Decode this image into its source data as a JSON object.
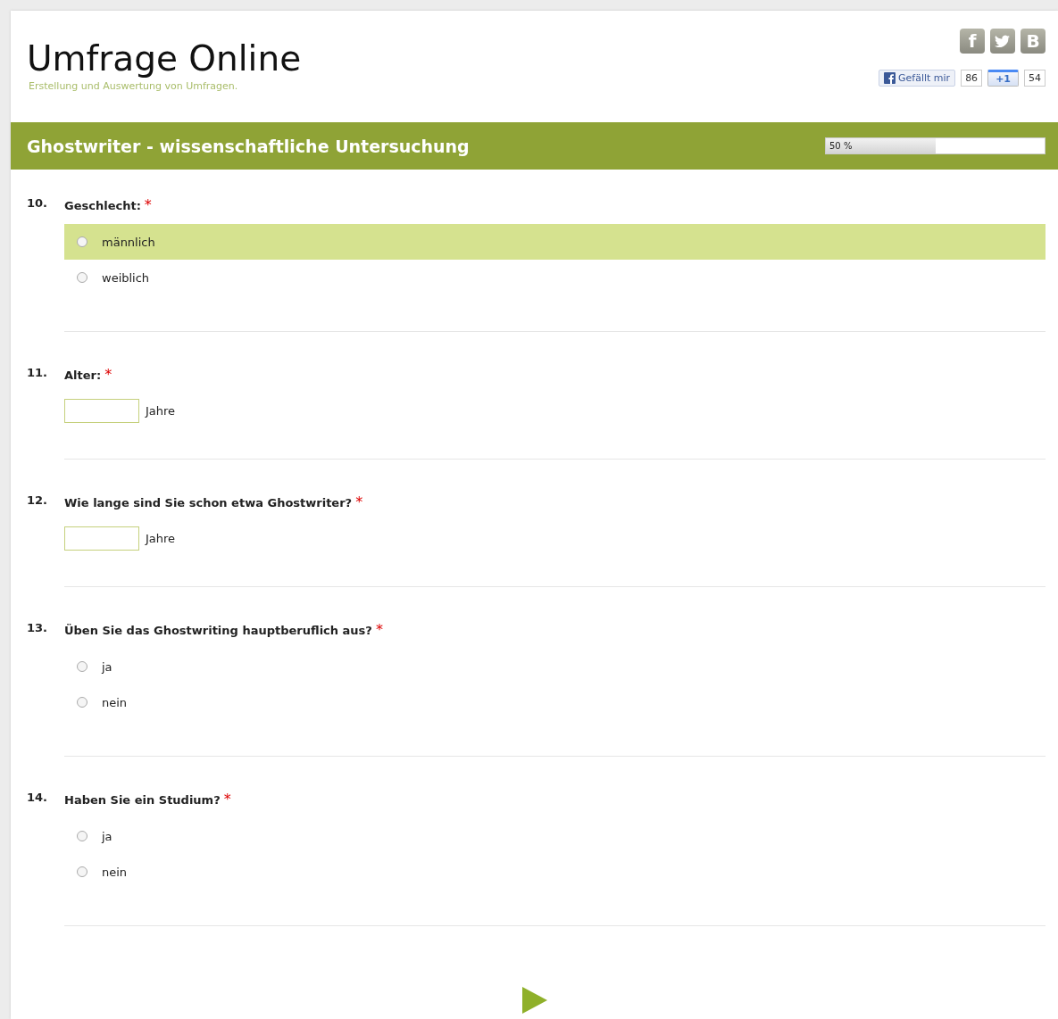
{
  "header": {
    "title": "Umfrage Online",
    "subtitle": "Erstellung und Auswertung von Umfragen.",
    "share_buttons": [
      {
        "kind": "letter",
        "label": "f"
      },
      {
        "kind": "bird"
      },
      {
        "kind": "letter",
        "label": "B"
      }
    ],
    "like_button": {
      "label": "Gefällt mir",
      "count": "86"
    },
    "plusone_button": {
      "label": "+1",
      "count": "54"
    }
  },
  "survey_bar": {
    "title": "Ghostwriter - wissenschaftliche Untersuchung",
    "progress": {
      "label": "50 %",
      "level": 0.5
    }
  },
  "questions": [
    {
      "number": "10.",
      "label": "Geschlecht:",
      "required_mark": "*",
      "kind": "radio",
      "options": [
        {
          "label": "männlich",
          "selected": false,
          "highlighted": true
        },
        {
          "label": "weiblich",
          "selected": false,
          "highlighted": false
        }
      ]
    },
    {
      "number": "11.",
      "label": "Alter:",
      "required_mark": "*",
      "kind": "text",
      "unit": "Jahre"
    },
    {
      "number": "12.",
      "label": "Wie lange sind Sie schon etwa Ghostwriter?",
      "required_mark": "*",
      "kind": "text",
      "unit": "Jahre"
    },
    {
      "number": "13.",
      "label": "Üben Sie das Ghostwriting hauptberuflich aus?",
      "required_mark": "*",
      "kind": "radio",
      "options": [
        {
          "label": "ja",
          "selected": false,
          "highlighted": false
        },
        {
          "label": "nein",
          "selected": false,
          "highlighted": false
        }
      ]
    },
    {
      "number": "14.",
      "label": "Haben Sie ein Studium?",
      "required_mark": "*",
      "kind": "radio",
      "options": [
        {
          "label": "ja",
          "selected": false,
          "highlighted": false
        },
        {
          "label": "nein",
          "selected": false,
          "highlighted": false
        }
      ]
    }
  ]
}
